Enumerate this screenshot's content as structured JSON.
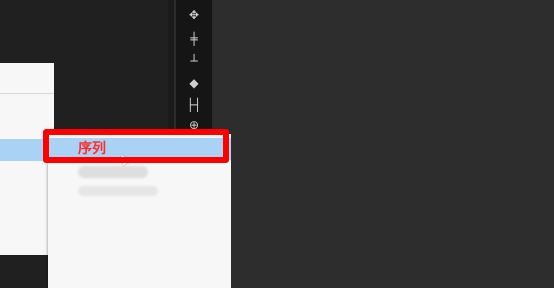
{
  "submenu": {
    "highlighted_item": "序列"
  },
  "toolbar": {
    "icons": [
      "move-icon",
      "align-vertical-center-icon",
      "align-bottom-icon",
      "diamond-icon",
      "distribute-horizontal-icon",
      "transform-icon"
    ]
  },
  "colors": {
    "menu_highlight": "#a9d2f5",
    "annotation": "#ff0000",
    "label_text": "#ff2d2d"
  }
}
